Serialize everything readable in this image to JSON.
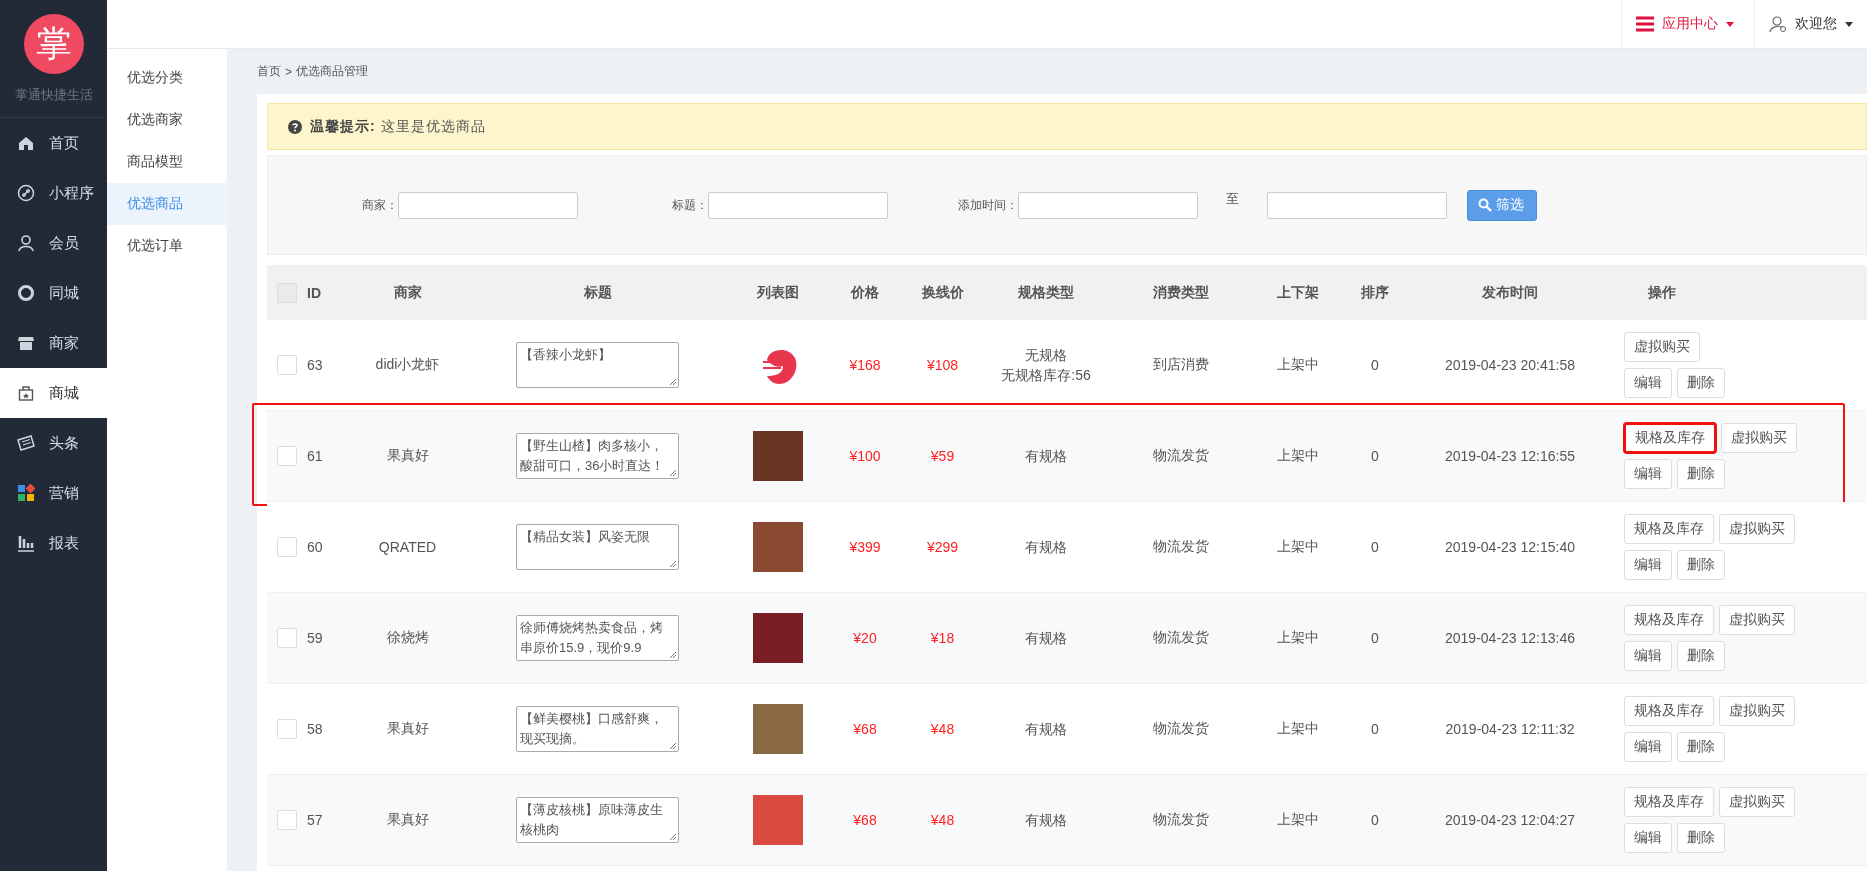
{
  "brand": {
    "logo_char": "掌",
    "name": "掌通快捷生活"
  },
  "nav": [
    {
      "label": "首页",
      "selected": false
    },
    {
      "label": "小程序",
      "selected": false
    },
    {
      "label": "会员",
      "selected": false
    },
    {
      "label": "同城",
      "selected": false
    },
    {
      "label": "商家",
      "selected": false
    },
    {
      "label": "商城",
      "selected": true
    },
    {
      "label": "头条",
      "selected": false
    },
    {
      "label": "营销",
      "selected": false
    },
    {
      "label": "报表",
      "selected": false
    }
  ],
  "topbar": {
    "app_center": "应用中心",
    "user": "欢迎您"
  },
  "subnav": [
    {
      "label": "优选分类",
      "selected": false
    },
    {
      "label": "优选商家",
      "selected": false
    },
    {
      "label": "商品模型",
      "selected": false
    },
    {
      "label": "优选商品",
      "selected": true
    },
    {
      "label": "优选订单",
      "selected": false
    }
  ],
  "breadcrumb": {
    "home": "首页",
    "separator": ">",
    "current": "优选商品管理"
  },
  "notice": "**温馨提示:** 这里是优选商品",
  "filters": [
    {
      "label": "商家："
    },
    {
      "label": "标题："
    },
    {
      "label": "添加时间：",
      "range_separator": "至"
    }
  ],
  "filter_button": "筛选",
  "table": {
    "select_all": {
      "checked": false
    },
    "columns": [
      "ID",
      "商家",
      "标题",
      "列表图",
      "价格",
      "换线价",
      "规格类型",
      "消费类型",
      "上下架",
      "排序",
      "发布时间",
      "操作"
    ],
    "rows": [
      {
        "checked": false,
        "highlighted": false,
        "id": "63",
        "merchant": "didi小龙虾",
        "title": "【香辣小龙虾】",
        "kind": "logo",
        "price": "¥168",
        "old_price": "¥108",
        "spec": [
          "无规格",
          "无规格库存:56"
        ],
        "consume": "到店消费",
        "status": "上架中",
        "sort": "0",
        "time": "2019-04-23 20:41:58",
        "actions": [
          [
            {
              "label": "虚拟购买",
              "highlighted": false
            }
          ],
          [
            {
              "label": "编辑",
              "highlighted": false
            },
            {
              "label": "删除",
              "highlighted": false
            }
          ]
        ]
      },
      {
        "checked": false,
        "highlighted": true,
        "id": "61",
        "merchant": "果真好",
        "title": "【野生山楂】肉多核小，酸甜可口，36小时直达！",
        "kind": "photo",
        "price": "¥100",
        "old_price": "¥59",
        "spec": [
          "有规格"
        ],
        "consume": "物流发货",
        "status": "上架中",
        "sort": "0",
        "time": "2019-04-23 12:16:55",
        "actions": [
          [
            {
              "label": "规格及库存",
              "highlighted": true
            },
            {
              "label": "虚拟购买",
              "highlighted": false
            }
          ],
          [
            {
              "label": "编辑",
              "highlighted": false
            },
            {
              "label": "删除",
              "highlighted": false
            }
          ]
        ]
      },
      {
        "checked": false,
        "highlighted": false,
        "id": "60",
        "merchant": "QRATED",
        "title": "【精品女装】风姿无限",
        "kind": "photo",
        "price": "¥399",
        "old_price": "¥299",
        "spec": [
          "有规格"
        ],
        "consume": "物流发货",
        "status": "上架中",
        "sort": "0",
        "time": "2019-04-23 12:15:40",
        "actions": [
          [
            {
              "label": "规格及库存",
              "highlighted": false
            },
            {
              "label": "虚拟购买",
              "highlighted": false
            }
          ],
          [
            {
              "label": "编辑",
              "highlighted": false
            },
            {
              "label": "删除",
              "highlighted": false
            }
          ]
        ]
      },
      {
        "checked": false,
        "highlighted": false,
        "id": "59",
        "merchant": "徐烧烤",
        "title": "徐师傅烧烤热卖食品，烤串原价15.9，现价9.9",
        "kind": "photo",
        "price": "¥20",
        "old_price": "¥18",
        "spec": [
          "有规格"
        ],
        "consume": "物流发货",
        "status": "上架中",
        "sort": "0",
        "time": "2019-04-23 12:13:46",
        "actions": [
          [
            {
              "label": "规格及库存",
              "highlighted": false
            },
            {
              "label": "虚拟购买",
              "highlighted": false
            }
          ],
          [
            {
              "label": "编辑",
              "highlighted": false
            },
            {
              "label": "删除",
              "highlighted": false
            }
          ]
        ]
      },
      {
        "checked": false,
        "highlighted": false,
        "id": "58",
        "merchant": "果真好",
        "title": "【鲜美樱桃】口感舒爽，现买现摘。",
        "kind": "photo",
        "price": "¥68",
        "old_price": "¥48",
        "spec": [
          "有规格"
        ],
        "consume": "物流发货",
        "status": "上架中",
        "sort": "0",
        "time": "2019-04-23 12:11:32",
        "actions": [
          [
            {
              "label": "规格及库存",
              "highlighted": false
            },
            {
              "label": "虚拟购买",
              "highlighted": false
            }
          ],
          [
            {
              "label": "编辑",
              "highlighted": false
            },
            {
              "label": "删除",
              "highlighted": false
            }
          ]
        ]
      },
      {
        "checked": false,
        "highlighted": false,
        "id": "57",
        "merchant": "果真好",
        "title": "【薄皮核桃】原味薄皮生核桃肉",
        "kind": "photo",
        "price": "¥68",
        "old_price": "¥48",
        "spec": [
          "有规格"
        ],
        "consume": "物流发货",
        "status": "上架中",
        "sort": "0",
        "time": "2019-04-23 12:04:27",
        "actions": [
          [
            {
              "label": "规格及库存",
              "highlighted": false
            },
            {
              "label": "虚拟购买",
              "highlighted": false
            }
          ],
          [
            {
              "label": "编辑",
              "highlighted": false
            },
            {
              "label": "删除",
              "highlighted": false
            }
          ]
        ]
      }
    ]
  }
}
